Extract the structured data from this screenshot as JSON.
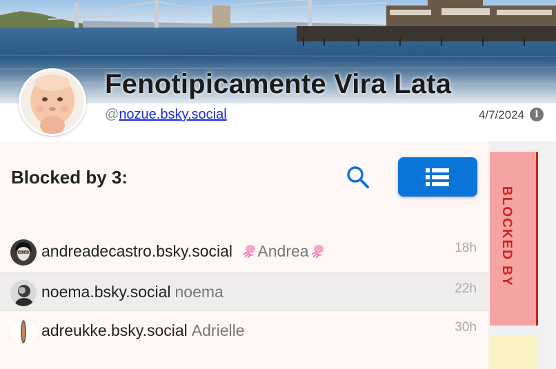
{
  "profile": {
    "display_name": "Fenotipicamente Vira Lata",
    "handle_prefix": "@",
    "handle": "nozue.bsky.social",
    "date": "4/7/2024",
    "info_glyph": "i"
  },
  "panel": {
    "title": "Blocked by 3:",
    "search_icon": "search-icon",
    "list_icon": "list-icon",
    "accent_color": "#0a74da"
  },
  "rows": [
    {
      "handle": "andreadecastro.bsky.social",
      "display": "Andrea",
      "time": "18h"
    },
    {
      "handle": "noema.bsky.social",
      "display": "noema",
      "time": "22h"
    },
    {
      "handle": "adreukke.bsky.social",
      "display": "Adrielle",
      "time": "30h"
    }
  ],
  "side_tabs": {
    "blocked_by": "BLOCKED BY",
    "blocked_color": "#c22222"
  }
}
